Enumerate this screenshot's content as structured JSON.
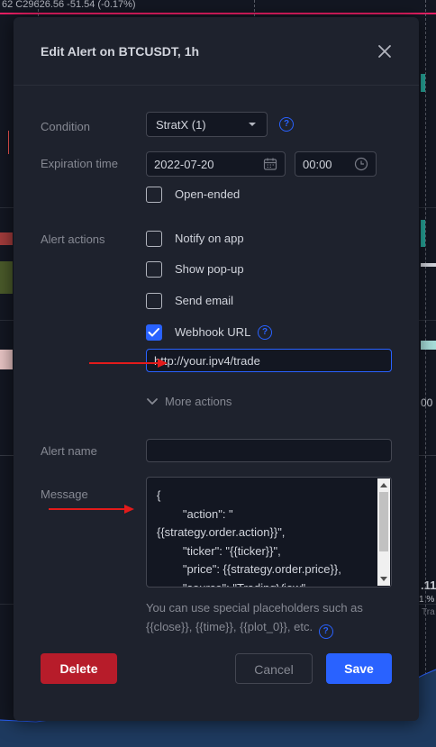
{
  "background": {
    "ticker_text": "62  C29626.56  -51.54 (-0.17%)",
    "right_labels": [
      ".11",
      "1 %",
      "Tra",
      "00"
    ]
  },
  "dialog": {
    "title": "Edit Alert on BTCUSDT, 1h",
    "condition": {
      "label": "Condition",
      "value": "StratX (1)"
    },
    "expiration": {
      "label": "Expiration time",
      "date": "2022-07-20",
      "time": "00:00"
    },
    "open_ended": {
      "label": "Open-ended",
      "checked": false
    },
    "alert_actions": {
      "label": "Alert actions",
      "items": [
        {
          "label": "Notify on app",
          "checked": false
        },
        {
          "label": "Show pop-up",
          "checked": false
        },
        {
          "label": "Send email",
          "checked": false
        },
        {
          "label": "Webhook URL",
          "checked": true
        }
      ],
      "webhook_url": "http://your.ipv4/trade",
      "more_actions": "More actions"
    },
    "alert_name": {
      "label": "Alert name",
      "value": ""
    },
    "message": {
      "label": "Message",
      "value": "{\n        \"action\": \"\n{{strategy.order.action}}\",\n        \"ticker\": \"{{ticker}}\",\n        \"price\": {{strategy.order.price}},\n        \"source\": \"TradingView\""
    },
    "hint": "You can use special placeholders such as {{close}}, {{time}}, {{plot_0}}, etc.",
    "buttons": {
      "delete": "Delete",
      "cancel": "Cancel",
      "save": "Save"
    }
  },
  "colors": {
    "accent": "#2962ff",
    "danger": "#b71c2a",
    "annotation_arrow": "#e31b1b"
  }
}
